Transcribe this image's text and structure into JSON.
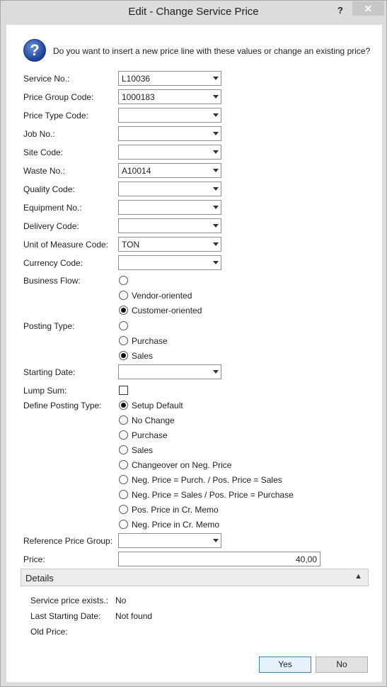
{
  "window": {
    "title": "Edit - Change Service Price",
    "help_label": "?",
    "close_label": "✕"
  },
  "question": {
    "icon": "question-icon",
    "icon_glyph": "?",
    "text": "Do you want to insert a new price line with these values or change an existing price?"
  },
  "fields": [
    {
      "label": "Service No.:",
      "value": "L10036"
    },
    {
      "label": "Price Group Code:",
      "value": "1000183"
    },
    {
      "label": "Price Type Code:",
      "value": ""
    },
    {
      "label": "Job No.:",
      "value": ""
    },
    {
      "label": "Site Code:",
      "value": ""
    },
    {
      "label": "Waste No.:",
      "value": "A10014"
    },
    {
      "label": "Quality Code:",
      "value": ""
    },
    {
      "label": "Equipment No.:",
      "value": ""
    },
    {
      "label": "Delivery Code:",
      "value": ""
    },
    {
      "label": "Unit of Measure Code:",
      "value": "TON"
    },
    {
      "label": "Currency Code:",
      "value": ""
    }
  ],
  "business_flow": {
    "label": "Business Flow:",
    "options": [
      {
        "label": "",
        "selected": false
      },
      {
        "label": "Vendor-oriented",
        "selected": false
      },
      {
        "label": "Customer-oriented",
        "selected": true
      }
    ]
  },
  "posting_type": {
    "label": "Posting Type:",
    "options": [
      {
        "label": "",
        "selected": false
      },
      {
        "label": "Purchase",
        "selected": false
      },
      {
        "label": "Sales",
        "selected": true
      }
    ]
  },
  "starting_date": {
    "label": "Starting Date:",
    "value": ""
  },
  "lump_sum": {
    "label": "Lump Sum:",
    "checked": false
  },
  "define_posting_type": {
    "label": "Define Posting Type:",
    "options": [
      {
        "label": "Setup Default",
        "selected": true
      },
      {
        "label": "No Change",
        "selected": false
      },
      {
        "label": "Purchase",
        "selected": false
      },
      {
        "label": "Sales",
        "selected": false
      },
      {
        "label": "Changeover on Neg. Price",
        "selected": false
      },
      {
        "label": "Neg. Price = Purch. / Pos. Price = Sales",
        "selected": false
      },
      {
        "label": "Neg. Price = Sales / Pos. Price = Purchase",
        "selected": false
      },
      {
        "label": "Pos. Price in Cr. Memo",
        "selected": false
      },
      {
        "label": "Neg. Price in Cr. Memo",
        "selected": false
      }
    ]
  },
  "reference_price_group": {
    "label": "Reference Price Group:",
    "value": ""
  },
  "price": {
    "label": "Price:",
    "value": "40,00"
  },
  "details": {
    "title": "Details",
    "collapse_icon": "chevron-up-icon",
    "collapse_glyph": "▲",
    "rows": [
      {
        "label": "Service price exists.:",
        "value": "No"
      },
      {
        "label": "Last Starting Date:",
        "value": "Not found"
      },
      {
        "label": "Old Price:",
        "value": ""
      }
    ]
  },
  "buttons": {
    "yes": "Yes",
    "no": "No"
  }
}
